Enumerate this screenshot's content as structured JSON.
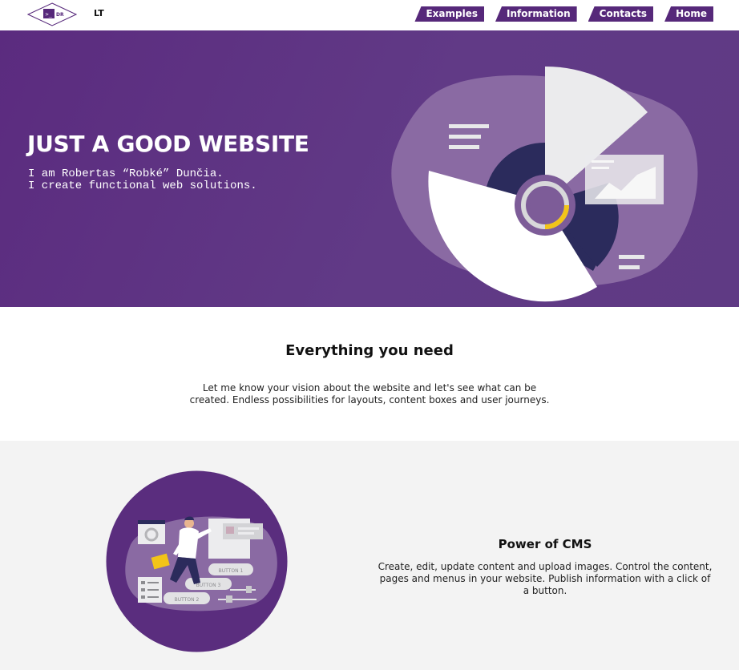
{
  "header": {
    "logo_text": "DR",
    "lang_label": "LT",
    "nav": [
      "Examples",
      "Information",
      "Contacts",
      "Home"
    ]
  },
  "hero": {
    "title": "JUST A GOOD WEBSITE",
    "subtitle_line1": "I am Robertas “Robké” Dunčia.",
    "subtitle_line2": "I create functional web solutions."
  },
  "section_everything": {
    "title": "Everything you need",
    "text_line1": "Let me know your vision about the website and let's see what can be",
    "text_line2": "created. Endless possibilities for layouts, content boxes and user journeys."
  },
  "section_cms": {
    "title": "Power of CMS",
    "text_line1": "Create, edit, update content and upload images. Control the content,",
    "text_line2": "pages and menus in your website. Publish information with a click of",
    "text_line3": "a button.",
    "illustration_buttons": [
      "BUTTON 1",
      "BUTTON 3",
      "BUTTON 2"
    ]
  },
  "colors": {
    "brand_purple": "#56287a",
    "hero_bg": "#5f3483",
    "accent_yellow": "#f2c418",
    "navy": "#2b2b5c"
  },
  "icons": [
    "terminal-logo-icon",
    "pie-chart-illustration",
    "cms-illustration"
  ]
}
